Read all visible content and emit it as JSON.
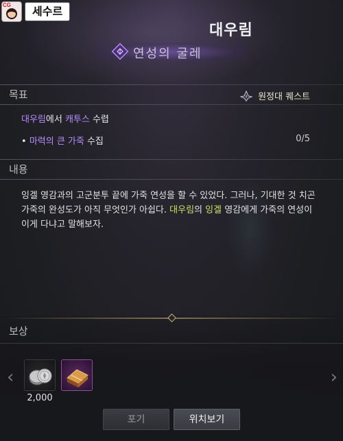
{
  "header": {
    "avatar_tag": "CG",
    "player_name": "세수르",
    "npc_name": "대우림",
    "quest_title": "연성의 굴레"
  },
  "goal": {
    "label": "목표",
    "quest_type": "원정대 퀘스트",
    "main_part1": "대우림",
    "main_part2": "에서 ",
    "main_part3": "캐투스",
    "main_part4": " 수렵",
    "item_bullet": "•",
    "item_name": "마력의 큰 가죽",
    "item_suffix": " 수집",
    "progress": "0/5"
  },
  "content": {
    "label": "내용",
    "text1": "잉겔 영감과의 고군분투 끝에 가죽 연성을 할 수 있었다. 그러나, 기대한 것 치곤 가죽의 완성도가 아직 무엇인가 아쉽다. ",
    "hl1": "대우림",
    "text2": "의 ",
    "hl2": "잉겔",
    "text3": " 영감에게 가죽의 연성이 이게 다냐고 말해보자."
  },
  "reward": {
    "label": "보상",
    "coin_count": "2,000",
    "left_arrow": "‹",
    "right_arrow": "›"
  },
  "buttons": {
    "give_up": "포기",
    "locate": "위치보기"
  },
  "colors": {
    "highlight_purple": "#b78cff",
    "highlight_green": "#c8e26a",
    "background": "#1b1c20"
  }
}
